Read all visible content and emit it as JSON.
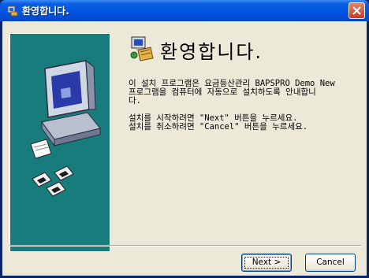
{
  "window": {
    "title": "환영합니다."
  },
  "header": {
    "title": "환영합니다."
  },
  "body": {
    "line1": "이 설치 프로그램은 요금등산관리 BAPSPRO Demo New",
    "line2": "프로그램을 컴퓨터에 자동으로 설치하도록 안내합니",
    "line3": "다.",
    "line4": "설치를 시작하려면 \"Next\" 버튼을 누르세요.",
    "line5": "설치를 취소하려면 \"Cancel\" 버튼을 누르세요."
  },
  "buttons": {
    "next": "Next >",
    "cancel": "Cancel"
  },
  "colors": {
    "titlebar": "#0054e3",
    "banner": "#197c7c",
    "client": "#ece9d8"
  }
}
